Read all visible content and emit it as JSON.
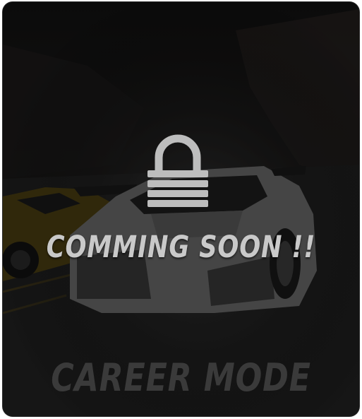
{
  "card": {
    "status_text": "COMMING SOON !!",
    "mode_title": "CAREER MODE",
    "locked": true,
    "lock_icon": "padlock-icon"
  },
  "colors": {
    "background": "#151515",
    "status_text": "#c9c9c9",
    "mode_title": "#3a3a3a",
    "lock_icon": "#bdbdbd"
  }
}
